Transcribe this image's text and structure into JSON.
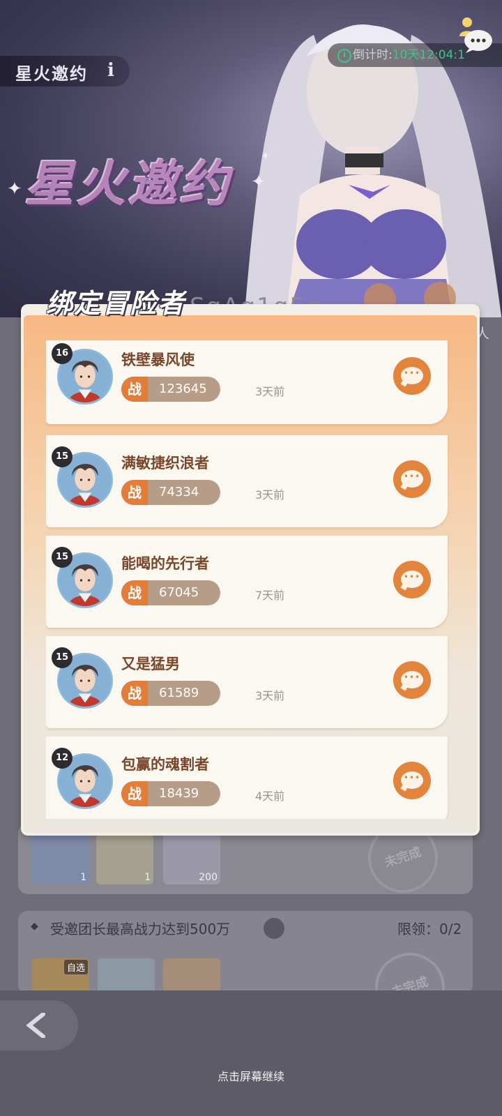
{
  "background": {
    "title": "星火邀约",
    "logo_text": "星火邀约",
    "timer_label": "倒计时:",
    "timer_value": "10天12:04:1",
    "name_text": "SgAg1g5g",
    "ren_text": "人",
    "items": [
      {
        "count": "1"
      },
      {
        "count": "1"
      },
      {
        "count": "200"
      }
    ],
    "stamp_text": "未完成",
    "task": {
      "text": "受邀团长最高战力达到500万",
      "limit": "限领：0/2",
      "self_pick": "自选"
    },
    "continue_text": "点击屏幕继续"
  },
  "modal": {
    "title": "绑定冒险者",
    "power_badge": "战",
    "rows": [
      {
        "level": "16",
        "name": "铁壁暴风使",
        "power": "123645",
        "ago": "3天前"
      },
      {
        "level": "15",
        "name": "满敏捷织浪者",
        "power": "74334",
        "ago": "3天前"
      },
      {
        "level": "15",
        "name": "能喝的先行者",
        "power": "67045",
        "ago": "7天前"
      },
      {
        "level": "15",
        "name": "又是猛男",
        "power": "61589",
        "ago": "3天前"
      },
      {
        "level": "12",
        "name": "包赢的魂割者",
        "power": "18439",
        "ago": "4天前"
      }
    ]
  },
  "colors": {
    "accent_orange": "#e27d3a",
    "name_brown": "#7a4528",
    "timer_green": "#3fc58a"
  },
  "icons": [
    "info-icon",
    "clock-icon",
    "chat-bubble-icon",
    "magnifier-icon",
    "back-arrow-icon",
    "message-icon",
    "avatar-portrait"
  ]
}
